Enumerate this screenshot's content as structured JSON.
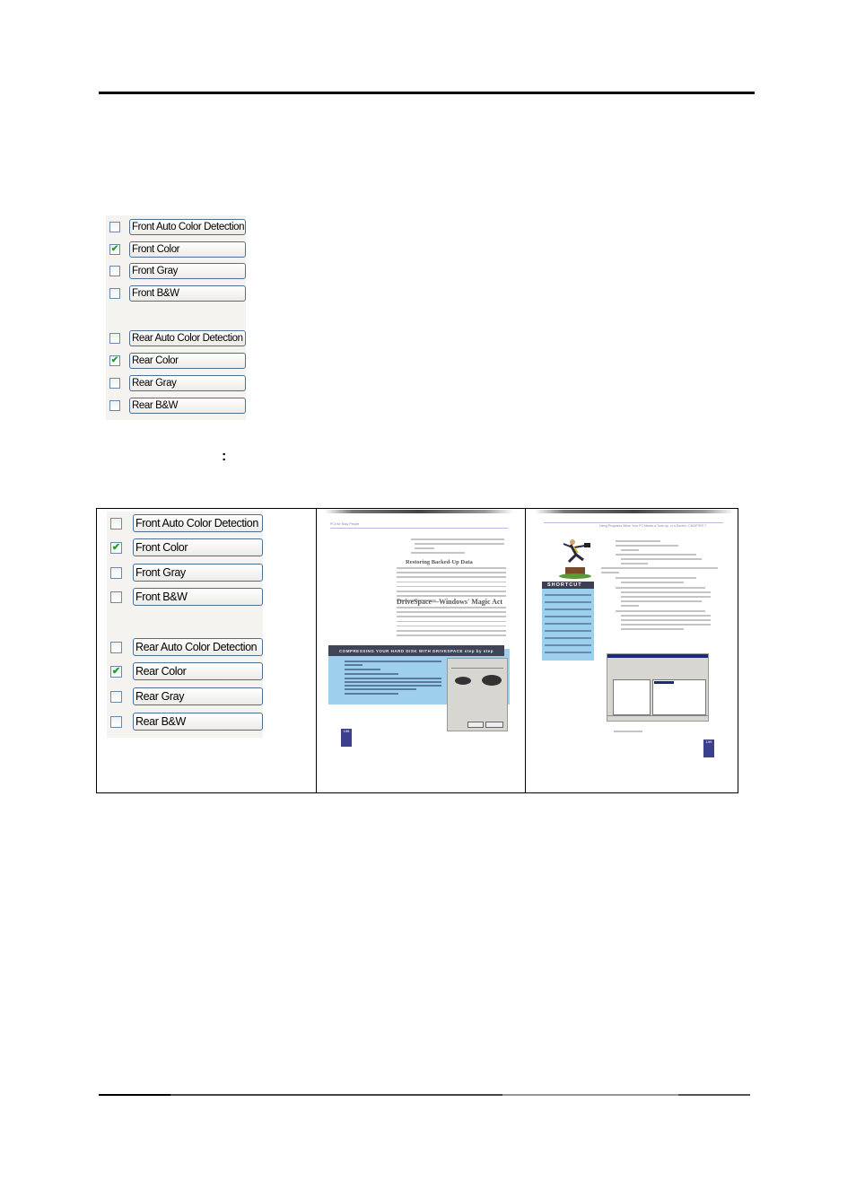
{
  "page": {
    "colon_text": ":"
  },
  "options_panel": {
    "front": [
      {
        "label": "Front Auto Color Detection",
        "checked": false,
        "mark": ""
      },
      {
        "label": "Front Color",
        "checked": true,
        "mark": "✔"
      },
      {
        "label": "Front Gray",
        "checked": false,
        "mark": ""
      },
      {
        "label": "Front B&W",
        "checked": false,
        "mark": ""
      }
    ],
    "rear": [
      {
        "label": "Rear Auto Color Detection",
        "checked": false,
        "mark": ""
      },
      {
        "label": "Rear Color",
        "checked": true,
        "mark": "✔"
      },
      {
        "label": "Rear Gray",
        "checked": false,
        "mark": ""
      },
      {
        "label": "Rear B&W",
        "checked": false,
        "mark": ""
      }
    ]
  },
  "sample_table": {
    "front_page": {
      "running_head": "PCs for Busy People",
      "heading1": "Restoring Backed-Up Data",
      "heading2": "DriveSpace—Windows' Magic Act",
      "banner": "COMPRESSING YOUR HARD DISK WITH DRIVESPACE step by step",
      "page_number": "198"
    },
    "rear_page": {
      "running_head": "Using Programs When Your PC Needs a Tune-up, or a Doctor • CHAPTER 7",
      "sidebar_title": "SHORTCUT",
      "page_number": "199"
    }
  },
  "colors": {
    "checkbox_border": "#6e8aa8",
    "check_mark": "#1ea11e",
    "button_border": "#4f6f95",
    "panel_bg": "#f4f3ef",
    "banner_bg": "#3f4458",
    "blue_box": "#9ed0ee",
    "page_number_bg": "#3b3f8c"
  }
}
